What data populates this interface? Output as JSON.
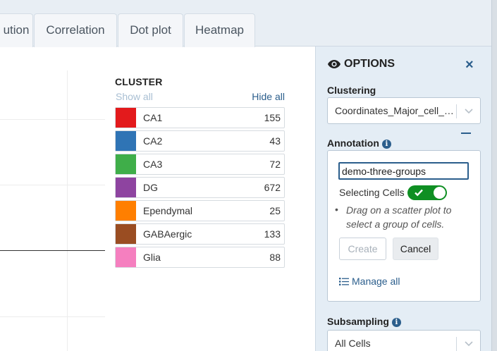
{
  "tabs": [
    {
      "label": "ution"
    },
    {
      "label": "Correlation"
    },
    {
      "label": "Dot plot"
    },
    {
      "label": "Heatmap"
    }
  ],
  "legend": {
    "title": "CLUSTER",
    "show_all": "Show all",
    "hide_all": "Hide all",
    "items": [
      {
        "label": "CA1",
        "count": "155",
        "color": "#e31a1c"
      },
      {
        "label": "CA2",
        "count": "43",
        "color": "#2f74b5"
      },
      {
        "label": "CA3",
        "count": "72",
        "color": "#3fae49"
      },
      {
        "label": "DG",
        "count": "672",
        "color": "#8e44a0"
      },
      {
        "label": "Ependymal",
        "count": "25",
        "color": "#ff7f00"
      },
      {
        "label": "GABAergic",
        "count": "133",
        "color": "#9a4d22"
      },
      {
        "label": "Glia",
        "count": "88",
        "color": "#f57fbf"
      }
    ]
  },
  "options": {
    "title": "OPTIONS",
    "close_icon": "×",
    "clustering": {
      "label": "Clustering",
      "value": "Coordinates_Major_cell_types"
    },
    "annotation": {
      "label": "Annotation",
      "info": "i",
      "input_value": "demo-three-groups",
      "selecting_label": "Selecting Cells",
      "selecting_on": true,
      "hint": "Drag on a scatter plot to select a group of cells.",
      "create_label": "Create",
      "cancel_label": "Cancel",
      "manage_label": "Manage all"
    },
    "subsampling": {
      "label": "Subsampling",
      "info": "i",
      "value": "All Cells"
    }
  },
  "colors": {
    "accent": "#2b5e8c",
    "toggle_on": "#0f8f23",
    "panel_bg": "#e4edf5"
  }
}
